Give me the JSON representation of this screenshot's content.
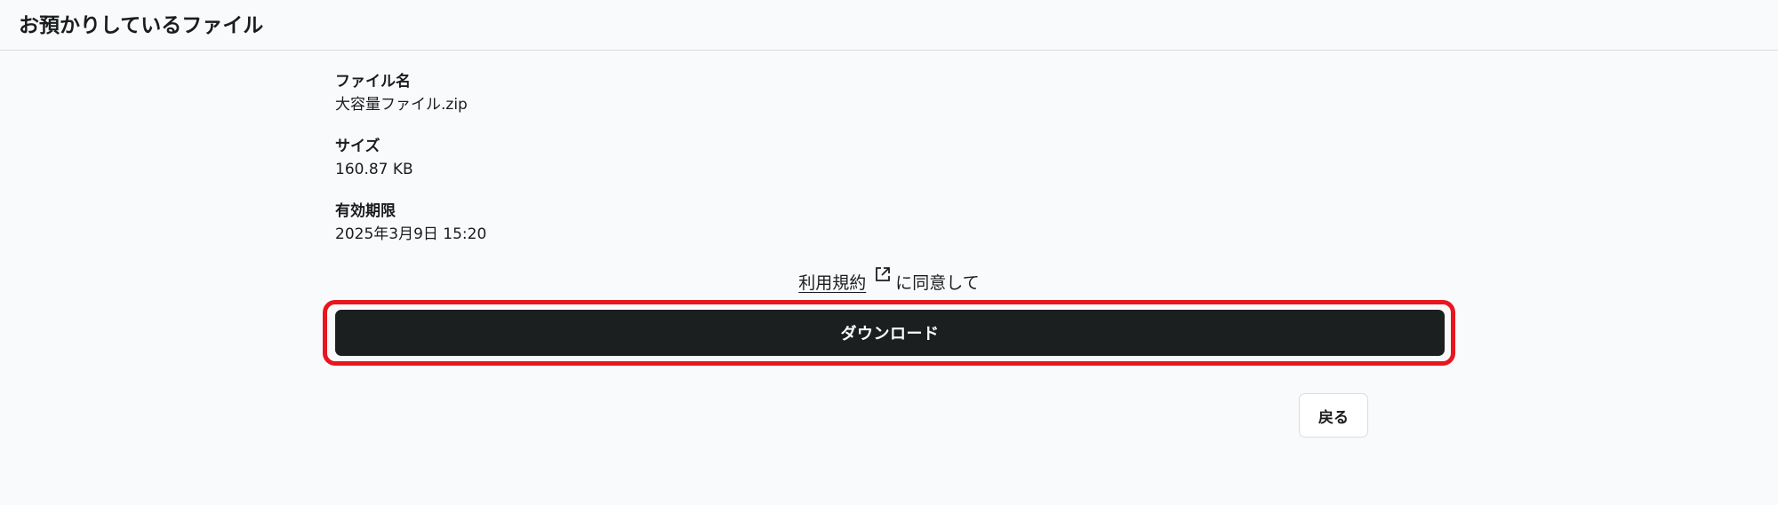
{
  "header": {
    "title": "お預かりしているファイル"
  },
  "file": {
    "name_label": "ファイル名",
    "name_value": "大容量ファイル.zip",
    "size_label": "サイズ",
    "size_value": "160.87 KB",
    "expiry_label": "有効期限",
    "expiry_value": "2025年3月9日 15:20"
  },
  "agreement": {
    "terms_link": "利用規約",
    "suffix": "に同意して",
    "icon": "external-link-icon"
  },
  "actions": {
    "download_label": "ダウンロード",
    "back_label": "戻る"
  },
  "colors": {
    "background": "#f9fafb",
    "primary_button": "#1c1f20",
    "highlight": "#e8161e"
  }
}
